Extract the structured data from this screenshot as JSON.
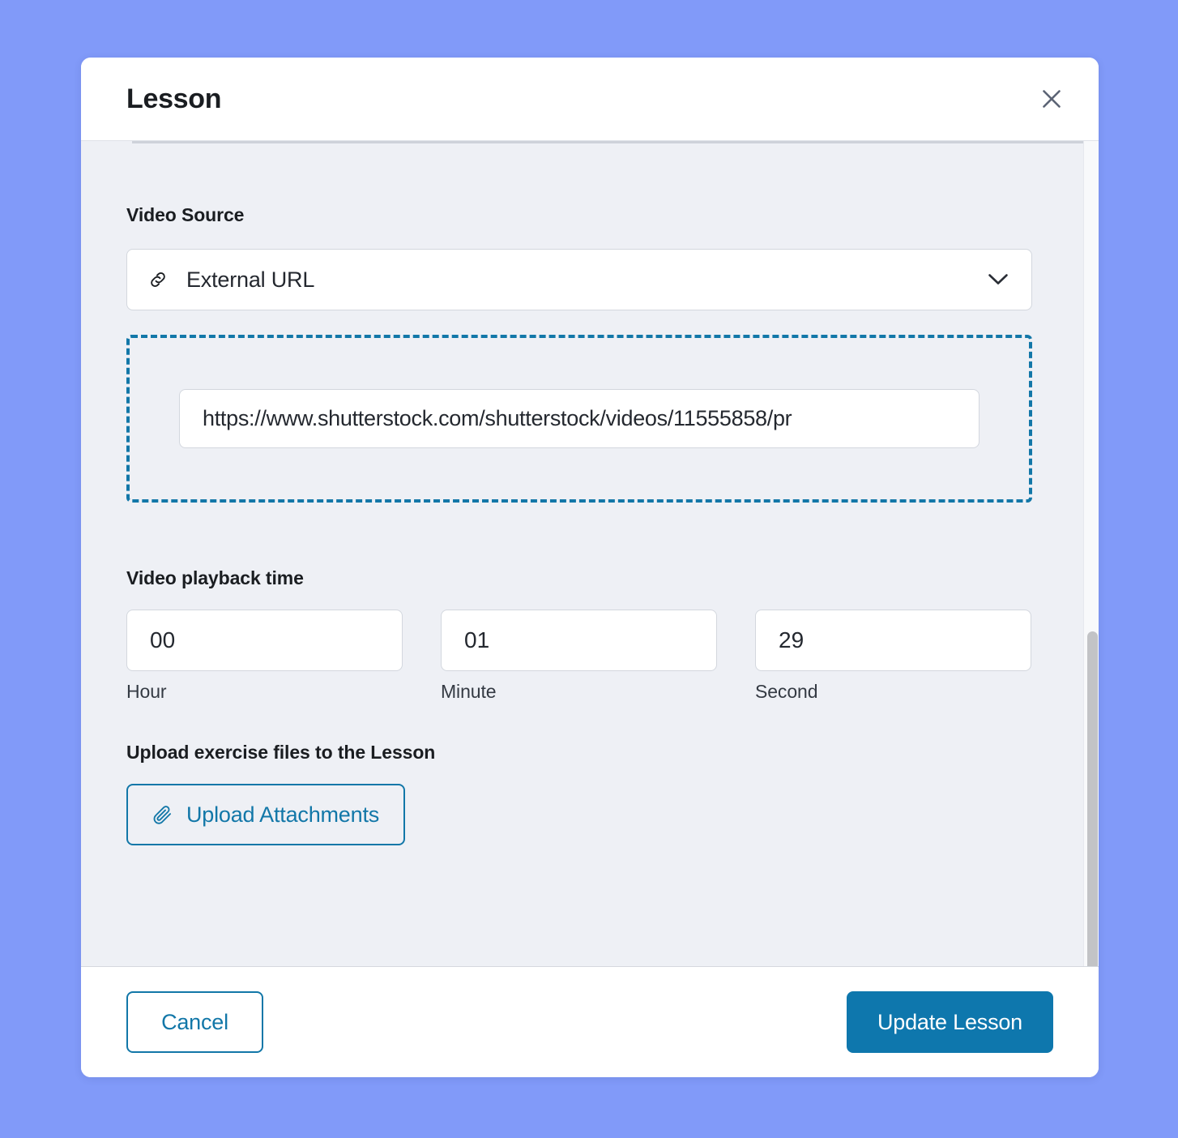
{
  "theme": {
    "page_background": "#819AF9",
    "modal_background": "#FFFFFF",
    "body_background": "#EEF0F5",
    "accent": "#1277A8",
    "primary_button": "#0E77AD",
    "text": "#1A1D21"
  },
  "modal": {
    "title": "Lesson",
    "close_icon": "close-icon"
  },
  "video_source": {
    "label": "Video Source",
    "selected_option": "External URL",
    "leading_icon": "link-icon",
    "chevron_icon": "chevron-down-icon"
  },
  "url_field": {
    "value": "https://www.shutterstock.com/shutterstock/videos/11555858/pr",
    "placeholder": "https://"
  },
  "playback": {
    "label": "Video playback time",
    "fields": [
      {
        "value": "00",
        "caption": "Hour",
        "name": "hour"
      },
      {
        "value": "01",
        "caption": "Minute",
        "name": "minute"
      },
      {
        "value": "29",
        "caption": "Second",
        "name": "second"
      }
    ]
  },
  "upload": {
    "label": "Upload exercise files to the Lesson",
    "button_label": "Upload Attachments",
    "button_icon": "paperclip-icon"
  },
  "footer": {
    "cancel_label": "Cancel",
    "update_label": "Update Lesson"
  },
  "scrollbar": {
    "orientation": "vertical"
  }
}
